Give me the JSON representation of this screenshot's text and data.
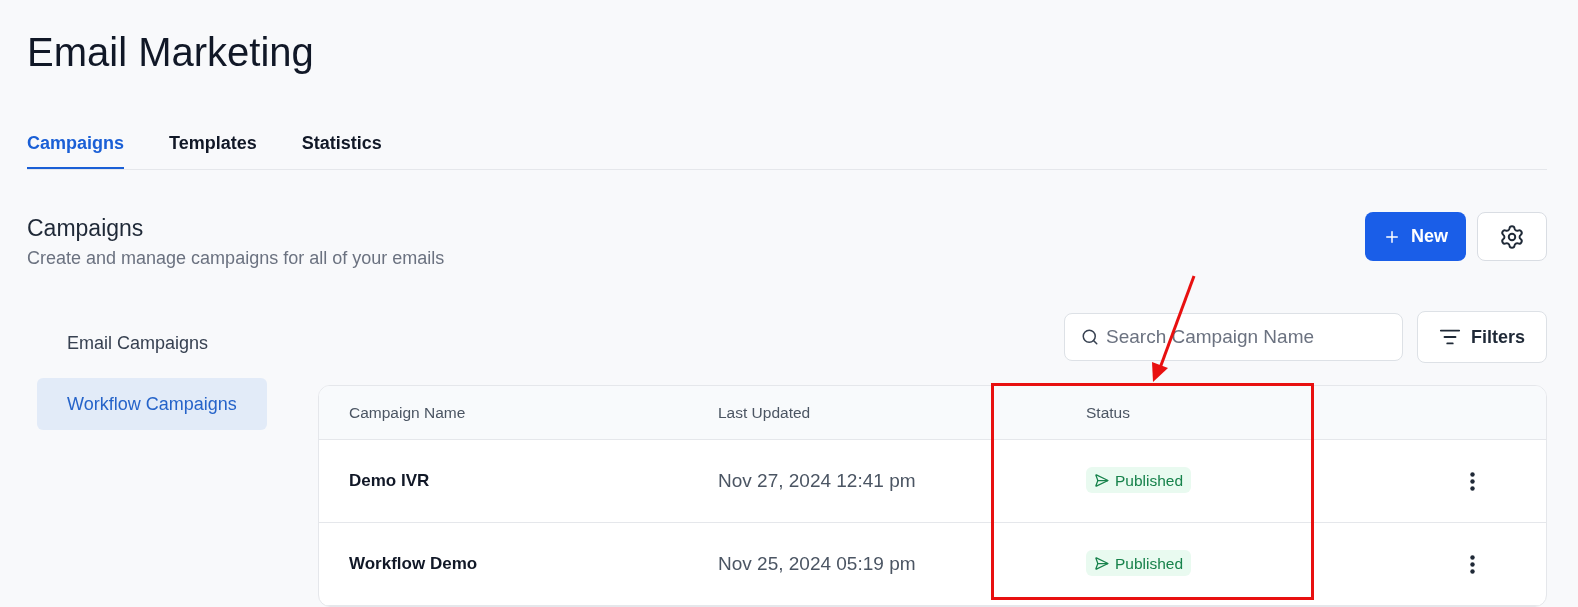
{
  "page": {
    "title": "Email Marketing"
  },
  "tabs": [
    {
      "label": "Campaigns",
      "selected": true
    },
    {
      "label": "Templates",
      "selected": false
    },
    {
      "label": "Statistics",
      "selected": false
    }
  ],
  "section": {
    "title": "Campaigns",
    "subtitle": "Create and manage campaigns for all of your emails",
    "new_button": "New"
  },
  "sidebar": {
    "items": [
      {
        "label": "Email Campaigns",
        "selected": false
      },
      {
        "label": "Workflow Campaigns",
        "selected": true
      }
    ]
  },
  "search": {
    "placeholder": "Search Campaign Name"
  },
  "filters_button": "Filters",
  "table": {
    "columns": [
      "Campaign Name",
      "Last Updated",
      "Status"
    ],
    "rows": [
      {
        "name": "Demo IVR",
        "updated": "Nov 27, 2024 12:41 pm",
        "status": "Published"
      },
      {
        "name": "Workflow Demo",
        "updated": "Nov 25, 2024 05:19 pm",
        "status": "Published"
      }
    ]
  }
}
